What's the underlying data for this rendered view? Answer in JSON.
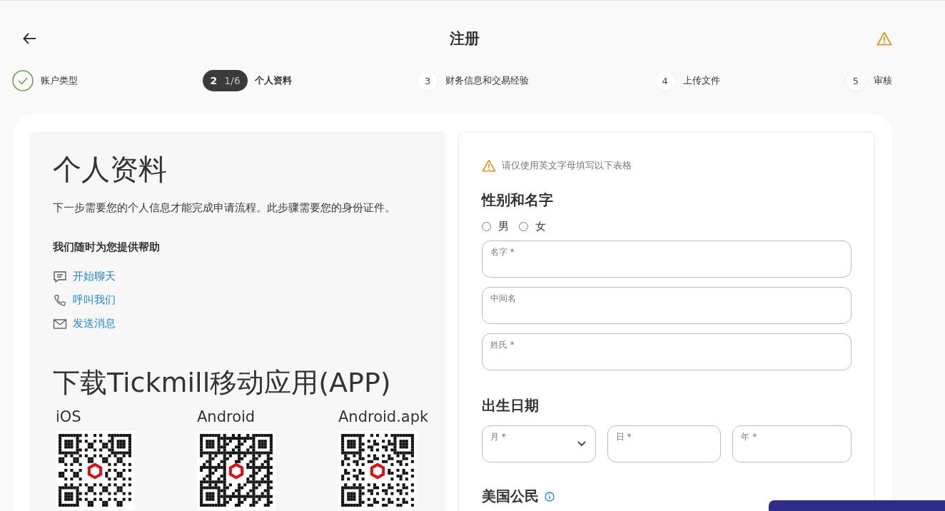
{
  "header": {
    "title": "注册"
  },
  "steps": [
    {
      "kind": "done",
      "label": "账户类型",
      "selected": false
    },
    {
      "kind": "current",
      "number": "2",
      "progress": "1/6",
      "label": "个人资料",
      "selected": true
    },
    {
      "kind": "pending",
      "number": "3",
      "label": "财务信息和交易经验",
      "selected": false
    },
    {
      "kind": "pending",
      "number": "4",
      "label": "上传文件",
      "selected": false
    },
    {
      "kind": "pending",
      "number": "5",
      "label": "审核",
      "selected": false
    }
  ],
  "info": {
    "title": "个人资料",
    "description": "下一步需要您的个人信息才能完成申请流程。此步骤需要您的身份证件。",
    "help_title": "我们随时为您提供帮助",
    "help_links": [
      {
        "kind": "chat",
        "label": "开始聊天"
      },
      {
        "kind": "phone",
        "label": "呼叫我们"
      },
      {
        "kind": "mail",
        "label": "发送消息"
      }
    ],
    "app_title": "下载Tickmill移动应用(APP)",
    "apps": [
      {
        "label": "iOS"
      },
      {
        "label": "Android"
      },
      {
        "label": "Android.apk"
      }
    ]
  },
  "form": {
    "notice": "请仅使用英文字母填写以下表格",
    "name_section": {
      "title": "性别和名字",
      "genders": [
        {
          "label": "男",
          "selected": false
        },
        {
          "label": "女",
          "selected": false
        }
      ],
      "fields": [
        {
          "placeholder": "名字 *"
        },
        {
          "placeholder": "中间名"
        },
        {
          "placeholder": "姓氏 *"
        }
      ]
    },
    "dob_section": {
      "title": "出生日期",
      "fields": [
        {
          "kind": "select",
          "placeholder": "月 *"
        },
        {
          "kind": "text",
          "placeholder": "日 *"
        },
        {
          "kind": "text",
          "placeholder": "年 *"
        }
      ]
    },
    "citizen_section": {
      "title": "美国公民"
    }
  }
}
